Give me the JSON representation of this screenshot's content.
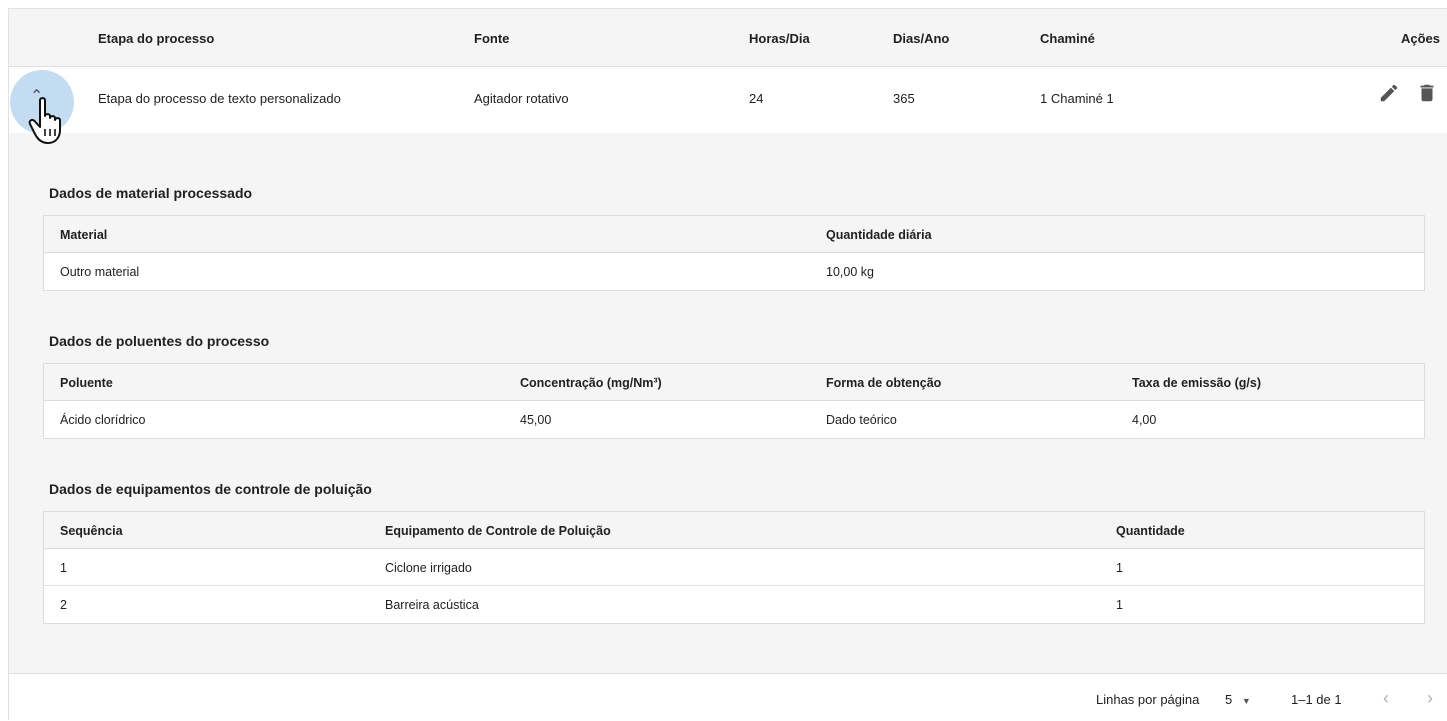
{
  "main_table": {
    "headers": {
      "stage": "Etapa do processo",
      "source": "Fonte",
      "hours": "Horas/Dia",
      "days": "Dias/Ano",
      "stack": "Chaminé",
      "actions": "Ações"
    },
    "row": {
      "stage": "Etapa do processo de texto personalizado",
      "source": "Agitador rotativo",
      "hours": "24",
      "days": "365",
      "stack": "1 Chaminé 1"
    },
    "icons": {
      "expand": "chevron-up-icon",
      "edit": "pencil-icon",
      "delete": "trash-icon"
    }
  },
  "material": {
    "title": "Dados de material processado",
    "headers": [
      "Material",
      "Quantidade diária"
    ],
    "rows": [
      [
        "Outro material",
        "10,00 kg"
      ]
    ]
  },
  "pollutants": {
    "title": "Dados de poluentes do processo",
    "headers": [
      "Poluente",
      "Concentração (mg/Nm³)",
      "Forma de obtenção",
      "Taxa de emissão (g/s)"
    ],
    "rows": [
      [
        "Ácido clorídrico",
        "45,00",
        "Dado teórico",
        "4,00"
      ]
    ]
  },
  "equipment": {
    "title": "Dados de equipamentos de controle de poluição",
    "headers": [
      "Sequência",
      "Equipamento de Controle de Poluição",
      "Quantidade"
    ],
    "rows": [
      [
        "1",
        "Ciclone irrigado",
        "1"
      ],
      [
        "2",
        "Barreira acústica",
        "1"
      ]
    ]
  },
  "pagination": {
    "rows_per_page_label": "Linhas por página",
    "rows_per_page_value": "5",
    "range": "1–1 de 1",
    "prev_glyph": "‹",
    "next_glyph": "›"
  },
  "colors": {
    "header_bg": "#f5f5f5",
    "expand_highlight": "#7cb2e2",
    "icon": "#555555",
    "border": "#e0e0e0"
  }
}
